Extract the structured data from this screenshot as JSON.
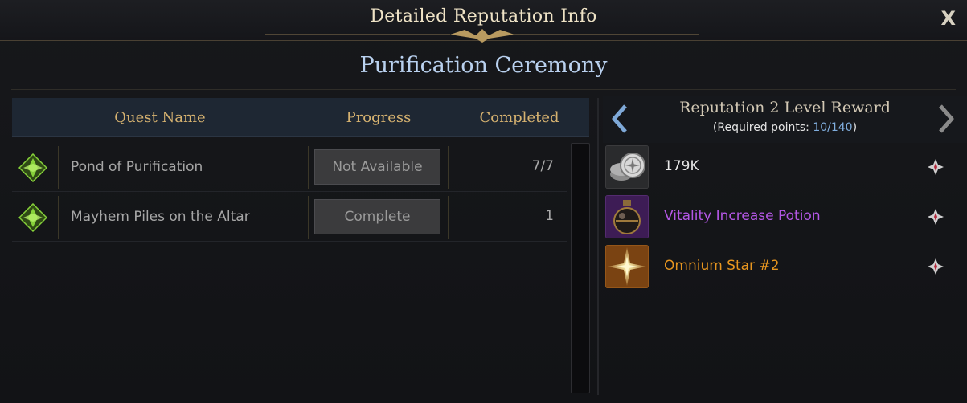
{
  "window": {
    "title": "Detailed Reputation Info",
    "close_label": "X"
  },
  "subtitle": "Purification Ceremony",
  "quest_table": {
    "headers": {
      "name": "Quest Name",
      "progress": "Progress",
      "completed": "Completed"
    },
    "rows": [
      {
        "name": "Pond of Purification",
        "progress": "Not Available",
        "completed": "7/7"
      },
      {
        "name": "Mayhem Piles on the Altar",
        "progress": "Complete",
        "completed": "1"
      }
    ]
  },
  "reward": {
    "title": "Reputation 2 Level Reward",
    "required_prefix": "(Required points: ",
    "current_points": "10",
    "slash": "/",
    "required_points": "140",
    "required_suffix": ")",
    "items": [
      {
        "name": "179K",
        "color": "#e8e8e8",
        "icon": "silver-coins-icon"
      },
      {
        "name": "Vitality Increase Potion",
        "color": "#b457e6",
        "icon": "potion-icon"
      },
      {
        "name": "Omnium Star #2",
        "color": "#e8961f",
        "icon": "omnium-star-icon"
      }
    ]
  },
  "colors": {
    "header_gold": "#d6b270",
    "subtitle_blue": "#b9d1ef",
    "quest_icon_green": "#86d13a"
  }
}
